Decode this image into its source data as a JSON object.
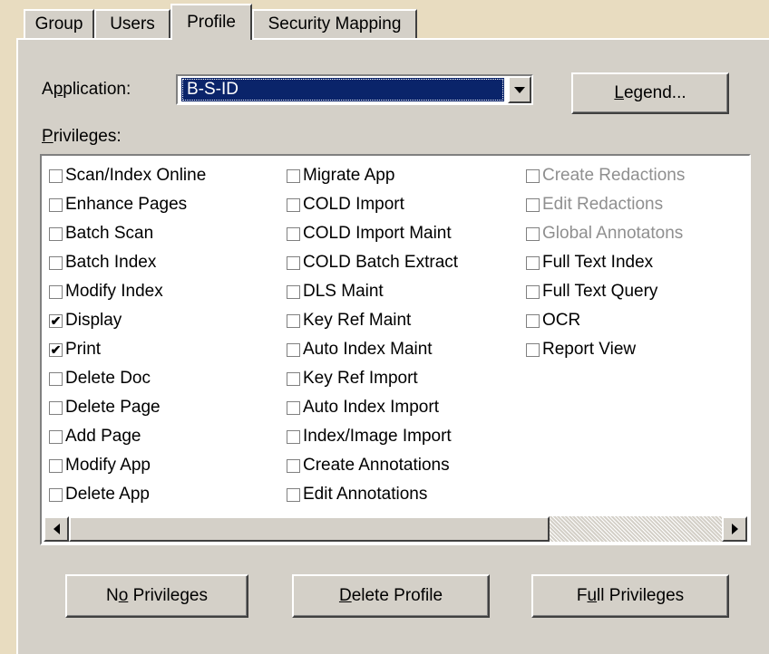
{
  "tabs": [
    {
      "label": "Group",
      "active": false
    },
    {
      "label": "Users",
      "active": false
    },
    {
      "label": "Profile",
      "active": true
    },
    {
      "label": "Security Mapping",
      "active": false
    }
  ],
  "application": {
    "label_before": "A",
    "label_mnemonic": "p",
    "label_after": "plication:",
    "value": "B-S-ID"
  },
  "legend_button": {
    "mnemonic": "L",
    "rest": "egend..."
  },
  "privileges_label": {
    "before": "",
    "mnemonic": "P",
    "after": "rivileges:"
  },
  "privileges": {
    "column1": [
      {
        "label": "Scan/Index Online",
        "checked": false,
        "enabled": true
      },
      {
        "label": "Enhance Pages",
        "checked": false,
        "enabled": true
      },
      {
        "label": "Batch Scan",
        "checked": false,
        "enabled": true
      },
      {
        "label": "Batch Index",
        "checked": false,
        "enabled": true
      },
      {
        "label": "Modify Index",
        "checked": false,
        "enabled": true
      },
      {
        "label": "Display",
        "checked": true,
        "enabled": true
      },
      {
        "label": "Print",
        "checked": true,
        "enabled": true
      },
      {
        "label": "Delete Doc",
        "checked": false,
        "enabled": true
      },
      {
        "label": "Delete Page",
        "checked": false,
        "enabled": true
      },
      {
        "label": "Add Page",
        "checked": false,
        "enabled": true
      },
      {
        "label": "Modify App",
        "checked": false,
        "enabled": true
      },
      {
        "label": "Delete App",
        "checked": false,
        "enabled": true
      }
    ],
    "column2": [
      {
        "label": "Migrate App",
        "checked": false,
        "enabled": true
      },
      {
        "label": "COLD Import",
        "checked": false,
        "enabled": true
      },
      {
        "label": "COLD Import Maint",
        "checked": false,
        "enabled": true
      },
      {
        "label": "COLD Batch Extract",
        "checked": false,
        "enabled": true
      },
      {
        "label": "DLS Maint",
        "checked": false,
        "enabled": true
      },
      {
        "label": "Key Ref Maint",
        "checked": false,
        "enabled": true
      },
      {
        "label": "Auto Index Maint",
        "checked": false,
        "enabled": true
      },
      {
        "label": "Key Ref Import",
        "checked": false,
        "enabled": true
      },
      {
        "label": "Auto Index Import",
        "checked": false,
        "enabled": true
      },
      {
        "label": "Index/Image Import",
        "checked": false,
        "enabled": true
      },
      {
        "label": "Create Annotations",
        "checked": false,
        "enabled": true
      },
      {
        "label": "Edit Annotations",
        "checked": false,
        "enabled": true
      }
    ],
    "column3": [
      {
        "label": "Create Redactions",
        "checked": false,
        "enabled": false
      },
      {
        "label": "Edit Redactions",
        "checked": false,
        "enabled": false
      },
      {
        "label": "Global Annotatons",
        "checked": false,
        "enabled": false
      },
      {
        "label": "Full Text Index",
        "checked": false,
        "enabled": true
      },
      {
        "label": "Full Text Query",
        "checked": false,
        "enabled": true
      },
      {
        "label": "OCR",
        "checked": false,
        "enabled": true
      },
      {
        "label": "Report View",
        "checked": false,
        "enabled": true
      }
    ]
  },
  "buttons": {
    "no_privileges": {
      "before": "N",
      "mnemonic": "o",
      "after": " Privileges"
    },
    "delete_profile": {
      "before": "",
      "mnemonic": "D",
      "after": "elete Profile"
    },
    "full_privileges": {
      "before": "F",
      "mnemonic": "u",
      "after": "ll Privileges"
    }
  },
  "icons": {
    "dropdown": "chevron-down-icon",
    "scroll_left": "arrow-left-icon",
    "scroll_right": "arrow-right-icon",
    "check": "checkmark-icon"
  },
  "colors": {
    "window_bg": "#e8dcc0",
    "dialog_face": "#d4d0c8",
    "selection": "#0a246a",
    "disabled_text": "#8f8f8f"
  }
}
